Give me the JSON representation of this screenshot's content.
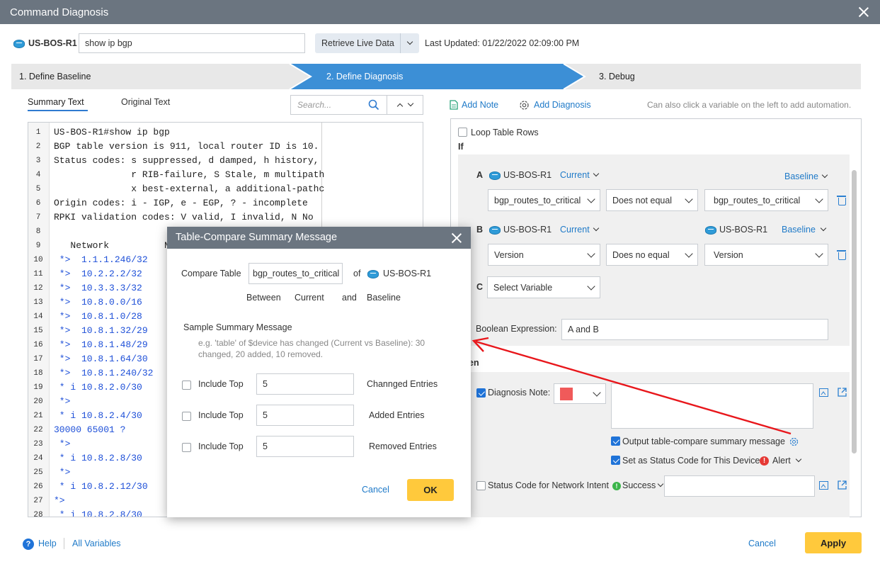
{
  "dialog": {
    "title": "Command Diagnosis"
  },
  "toolbar": {
    "device": "US-BOS-R1",
    "command": "show ip bgp",
    "retrieve_label": "Retrieve Live Data",
    "last_updated": "Last Updated: 01/22/2022 02:09:00 PM"
  },
  "steps": [
    {
      "label": "1. Define Baseline"
    },
    {
      "label": "2. Define Diagnosis"
    },
    {
      "label": "3. Debug"
    }
  ],
  "left": {
    "tabs": [
      {
        "label": "Summary Text"
      },
      {
        "label": "Original Text"
      }
    ],
    "search_placeholder": "Search...",
    "code": [
      {
        "n": "1",
        "t": "US-BOS-R1#show ip bgp"
      },
      {
        "n": "2",
        "t": "BGP table version is 911, local router ID is 10."
      },
      {
        "n": "3",
        "t": "Status codes: s suppressed, d damped, h history,"
      },
      {
        "n": "4",
        "t": "              r RIB-failure, S Stale, m multipath"
      },
      {
        "n": "5",
        "t": "              x best-external, a additional-pathc"
      },
      {
        "n": "6",
        "t": "Origin codes: i - IGP, e - EGP, ? - incomplete"
      },
      {
        "n": "7",
        "t": "RPKI validation codes: V valid, I invalid, N No"
      },
      {
        "n": "8",
        "t": ""
      },
      {
        "n": "9",
        "t": "   Network          N"
      },
      {
        "n": "10",
        "t": " *>  1.1.1.246/32"
      },
      {
        "n": "11",
        "t": " *>  10.2.2.2/32"
      },
      {
        "n": "12",
        "t": " *>  10.3.3.3/32"
      },
      {
        "n": "13",
        "t": " *>  10.8.0.0/16"
      },
      {
        "n": "14",
        "t": " *>  10.8.1.0/28"
      },
      {
        "n": "15",
        "t": " *>  10.8.1.32/29"
      },
      {
        "n": "16",
        "t": " *>  10.8.1.48/29"
      },
      {
        "n": "17",
        "t": " *>  10.8.1.64/30"
      },
      {
        "n": "18",
        "t": " *>  10.8.1.240/32"
      },
      {
        "n": "19",
        "t": " * i 10.8.2.0/30"
      },
      {
        "n": "20",
        "t": " *>"
      },
      {
        "n": "21",
        "t": " * i 10.8.2.4/30"
      },
      {
        "n": "22",
        "t": "30000 65001 ?"
      },
      {
        "n": "23",
        "t": " *>"
      },
      {
        "n": "24",
        "t": " * i 10.8.2.8/30"
      },
      {
        "n": "25",
        "t": " *>"
      },
      {
        "n": "26",
        "t": " * i 10.8.2.12/30"
      },
      {
        "n": "27",
        "t": "*>"
      },
      {
        "n": "28",
        "t": " * i 10.8.2.8/30"
      }
    ]
  },
  "right": {
    "add_note": "Add Note",
    "add_diagnosis": "Add Diagnosis",
    "hint": "Can also click a variable on the left to add automation.",
    "loop_rows": "Loop Table Rows",
    "if_label": "If",
    "then_label": "en",
    "cond_a": {
      "letter": "A",
      "device": "US-BOS-R1",
      "scope": "Current",
      "baseline": "Baseline",
      "var1": "bgp_routes_to_critical",
      "op": "Does not equal",
      "var2": "bgp_routes_to_critical"
    },
    "cond_b": {
      "letter": "B",
      "device": "US-BOS-R1",
      "scope": "Current",
      "device2": "US-BOS-R1",
      "baseline": "Baseline",
      "var1": "Version",
      "op": "Does no equal",
      "var2": "Version"
    },
    "cond_c": {
      "letter": "C",
      "var": "Select Variable"
    },
    "bool_label": "Boolean Expression:",
    "bool_value": "A and B",
    "diag_note": "Diagnosis Note:",
    "note_color": "#f05a5a",
    "output_msg": "Output table-compare summary message",
    "set_status": "Set as Status Code for This Device",
    "alert": "Alert",
    "status_intent": "Status Code for Network Intent",
    "success": "Success"
  },
  "modal": {
    "title": "Table-Compare Summary Message",
    "compare_label": "Compare Table",
    "table": "bgp_routes_to_critical",
    "of": "of",
    "device": "US-BOS-R1",
    "between": "Between",
    "current": "Current",
    "and": "and",
    "baseline": "Baseline",
    "sample_label": "Sample Summary Message",
    "sample_text": "e.g. 'table' of $device has changed (Current vs Baseline): 30 changed, 20 added, 10 removed.",
    "rows": [
      {
        "label": "Include Top",
        "value": "5",
        "suffix": "Channged Entries"
      },
      {
        "label": "Include Top",
        "value": "5",
        "suffix": "Added Entries"
      },
      {
        "label": "Include Top",
        "value": "5",
        "suffix": "Removed Entries"
      }
    ],
    "cancel": "Cancel",
    "ok": "OK"
  },
  "footer": {
    "help": "Help",
    "all_vars": "All Variables",
    "cancel": "Cancel",
    "apply": "Apply"
  }
}
